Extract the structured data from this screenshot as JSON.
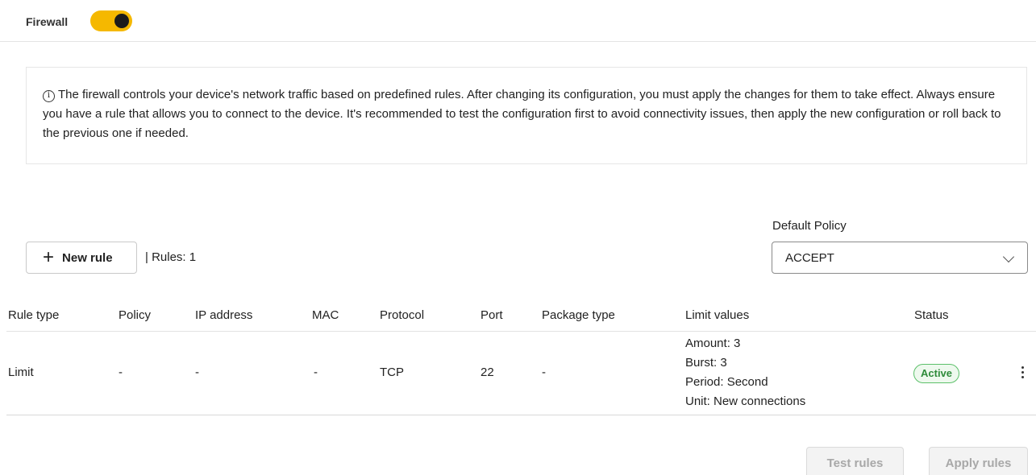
{
  "header": {
    "label": "Firewall",
    "toggle_on": true,
    "toggle_color": "#f5b800"
  },
  "info": {
    "icon": "info-circle-icon",
    "text": "The firewall controls your device's network traffic based on predefined rules. After changing its configuration, you must apply the changes for them to take effect. Always ensure you have a rule that allows you to connect to the device. It's recommended to test the configuration first to avoid connectivity issues, then apply the new configuration or roll back to the previous one if needed."
  },
  "toolbar": {
    "new_rule_label": "New rule",
    "rules_count": "| Rules: 1",
    "default_policy_label": "Default Policy",
    "default_policy_value": "ACCEPT"
  },
  "table": {
    "headers": [
      "Rule type",
      "Policy",
      "IP address",
      "MAC",
      "Protocol",
      "Port",
      "Package type",
      "Limit values",
      "Status"
    ],
    "rows": [
      {
        "rule_type": "Limit",
        "policy": "-",
        "ip_address": "-",
        "mac": "-",
        "protocol": "TCP",
        "port": "22",
        "package_type": "-",
        "limit_values": [
          "Amount: 3",
          "Burst: 3",
          "Period: Second",
          "Unit: New connections"
        ],
        "status": "Active"
      }
    ]
  },
  "footer": {
    "test_label": "Test rules",
    "apply_label": "Apply rules"
  },
  "colors": {
    "accent": "#f5b800",
    "status_active": "#2e8b3a"
  }
}
